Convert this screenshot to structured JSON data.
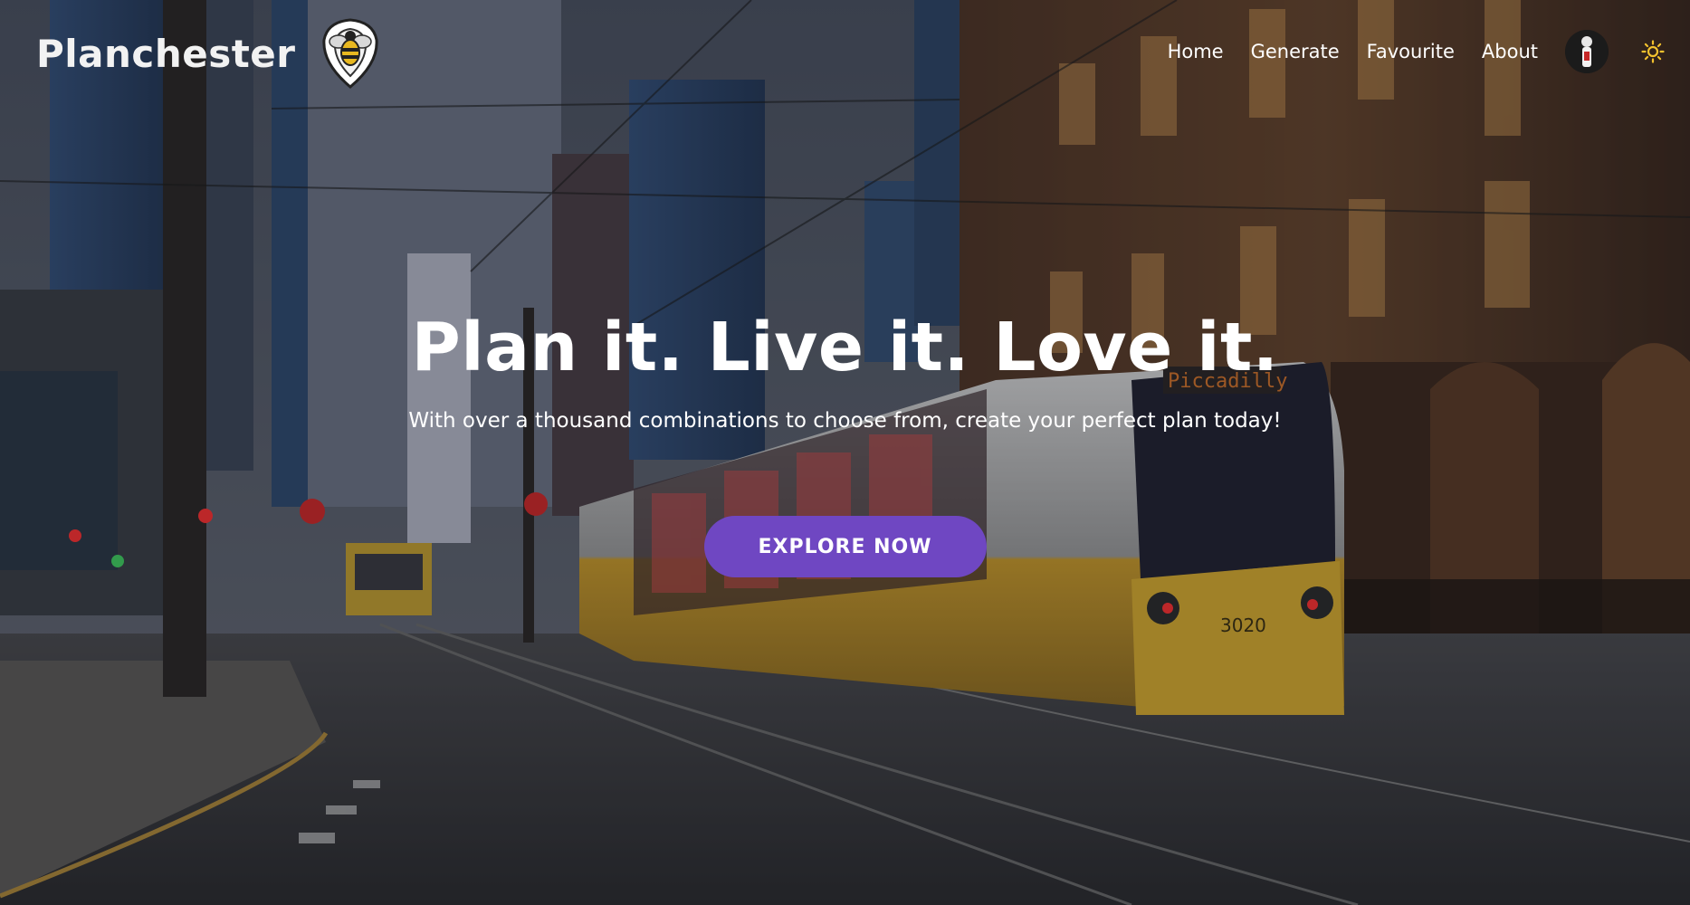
{
  "brand": {
    "name": "Planchester",
    "logo_icon": "bee-shield-icon"
  },
  "nav": {
    "links": [
      {
        "label": "Home"
      },
      {
        "label": "Generate"
      },
      {
        "label": "Favourite"
      },
      {
        "label": "About"
      }
    ],
    "avatar_icon": "user-avatar-icon",
    "theme_icon": "sun-icon"
  },
  "hero": {
    "title": "Plan it. Live it. Love it.",
    "subtitle": "With over a thousand combinations to choose from, create your perfect plan today!",
    "cta_label": "EXPLORE NOW",
    "background": "manchester-street-tram-photo"
  },
  "colors": {
    "accent": "#6f47c2",
    "sun": "#f2c12e",
    "text": "#ffffff"
  }
}
